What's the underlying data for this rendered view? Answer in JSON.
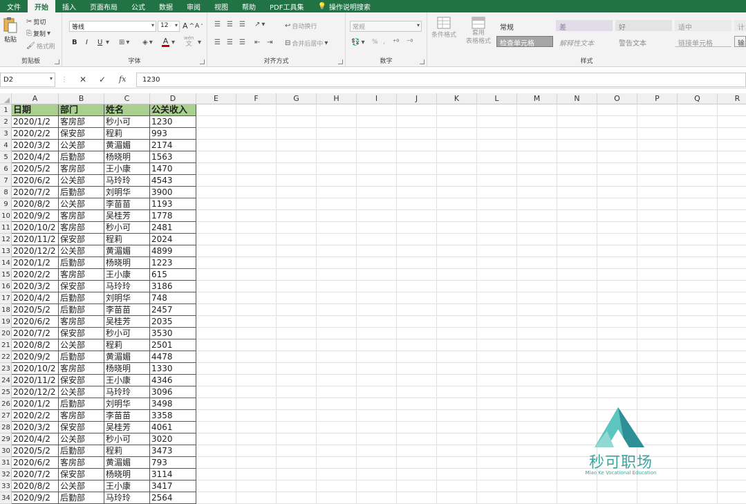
{
  "tabs": [
    "文件",
    "开始",
    "插入",
    "页面布局",
    "公式",
    "数据",
    "审阅",
    "视图",
    "帮助",
    "PDF工具集",
    "操作说明搜索"
  ],
  "active_tab": "开始",
  "clipboard": {
    "label": "剪贴板",
    "paste": "粘贴",
    "cut": "剪切",
    "copy": "复制",
    "format_painter": "格式刷"
  },
  "font": {
    "label": "字体",
    "name": "等线",
    "size": "12",
    "bold": "B",
    "italic": "I",
    "underline": "U",
    "grow": "A",
    "shrink": "A",
    "wen": "wén",
    "wen_sub": "文"
  },
  "alignment": {
    "label": "对齐方式",
    "wrap": "自动换行",
    "merge": "合并后居中"
  },
  "number": {
    "label": "数字",
    "format": "常规",
    "percent": "%",
    "comma": ","
  },
  "styles": {
    "label": "样式",
    "conditional": "条件格式",
    "table": [
      "套用",
      "表格格式"
    ],
    "cells": [
      "常规",
      "差",
      "好",
      "适中",
      "计算",
      "检查单元格",
      "解释性文本",
      "警告文本",
      "链接单元格",
      "输出"
    ]
  },
  "formula_bar": {
    "name_box": "D2",
    "fx": "fx",
    "value": "1230"
  },
  "columns": [
    "A",
    "B",
    "C",
    "D",
    "E",
    "F",
    "G",
    "H",
    "I",
    "J",
    "K",
    "L",
    "M",
    "N",
    "O",
    "P",
    "Q",
    "R"
  ],
  "table": {
    "headers": [
      "日期",
      "部门",
      "姓名",
      "公关收入"
    ],
    "rows": [
      [
        "2020/1/2",
        "客房部",
        "秒小可",
        "1230"
      ],
      [
        "2020/2/2",
        "保安部",
        "程莉",
        "993"
      ],
      [
        "2020/3/2",
        "公关部",
        "黄湄媚",
        "2174"
      ],
      [
        "2020/4/2",
        "后勤部",
        "杨晓明",
        "1563"
      ],
      [
        "2020/5/2",
        "客房部",
        "王小康",
        "1470"
      ],
      [
        "2020/6/2",
        "公关部",
        "马玲玲",
        "4543"
      ],
      [
        "2020/7/2",
        "后勤部",
        "刘明华",
        "3900"
      ],
      [
        "2020/8/2",
        "公关部",
        "李苗苗",
        "1193"
      ],
      [
        "2020/9/2",
        "客房部",
        "吴桂芳",
        "1778"
      ],
      [
        "2020/10/2",
        "客房部",
        "秒小可",
        "2481"
      ],
      [
        "2020/11/2",
        "保安部",
        "程莉",
        "2024"
      ],
      [
        "2020/12/2",
        "公关部",
        "黄湄媚",
        "4899"
      ],
      [
        "2020/1/2",
        "后勤部",
        "杨晓明",
        "1223"
      ],
      [
        "2020/2/2",
        "客房部",
        "王小康",
        "615"
      ],
      [
        "2020/3/2",
        "保安部",
        "马玲玲",
        "3186"
      ],
      [
        "2020/4/2",
        "后勤部",
        "刘明华",
        "748"
      ],
      [
        "2020/5/2",
        "后勤部",
        "李苗苗",
        "2457"
      ],
      [
        "2020/6/2",
        "客房部",
        "吴桂芳",
        "2035"
      ],
      [
        "2020/7/2",
        "保安部",
        "秒小可",
        "3530"
      ],
      [
        "2020/8/2",
        "公关部",
        "程莉",
        "2501"
      ],
      [
        "2020/9/2",
        "后勤部",
        "黄湄媚",
        "4478"
      ],
      [
        "2020/10/2",
        "客房部",
        "杨晓明",
        "1330"
      ],
      [
        "2020/11/2",
        "保安部",
        "王小康",
        "4346"
      ],
      [
        "2020/12/2",
        "公关部",
        "马玲玲",
        "3096"
      ],
      [
        "2020/1/2",
        "后勤部",
        "刘明华",
        "3498"
      ],
      [
        "2020/2/2",
        "客房部",
        "李苗苗",
        "3358"
      ],
      [
        "2020/3/2",
        "保安部",
        "吴桂芳",
        "4061"
      ],
      [
        "2020/4/2",
        "公关部",
        "秒小可",
        "3020"
      ],
      [
        "2020/5/2",
        "后勤部",
        "程莉",
        "3473"
      ],
      [
        "2020/6/2",
        "客房部",
        "黄湄媚",
        "793"
      ],
      [
        "2020/7/2",
        "保安部",
        "杨晓明",
        "3114"
      ],
      [
        "2020/8/2",
        "公关部",
        "王小康",
        "3417"
      ],
      [
        "2020/9/2",
        "后勤部",
        "马玲玲",
        "2564"
      ]
    ]
  },
  "watermark": {
    "title": "秒可职场",
    "subtitle": "Miao Ke Vocational Education",
    "color": "#3aa6a0"
  }
}
